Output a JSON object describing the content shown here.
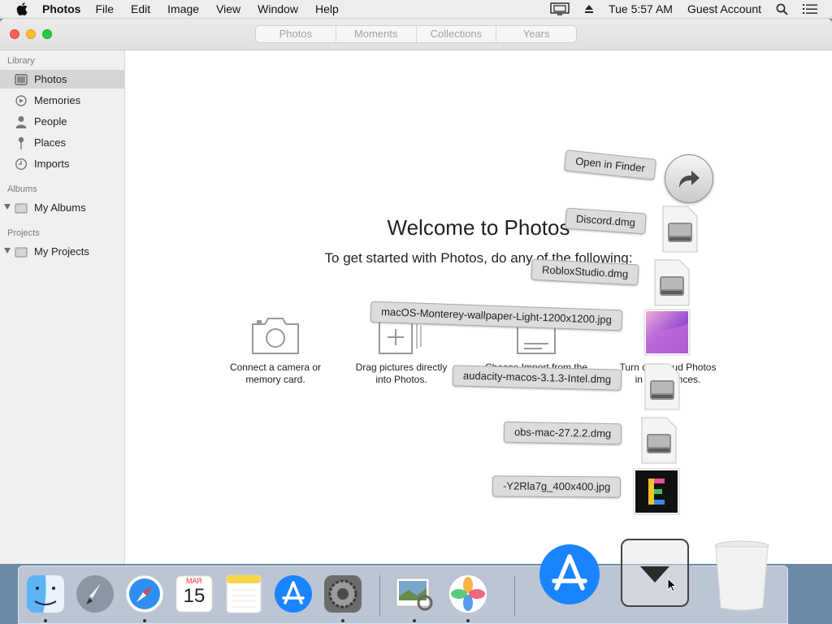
{
  "menubar": {
    "app_name": "Photos",
    "menus": [
      "File",
      "Edit",
      "Image",
      "View",
      "Window",
      "Help"
    ],
    "clock": "Tue 5:57 AM",
    "user": "Guest Account",
    "icons": [
      "apple-logo",
      "display-mirror-icon",
      "eject-icon",
      "search-icon",
      "list-icon"
    ]
  },
  "toolbar": {
    "tabs": [
      "Photos",
      "Moments",
      "Collections",
      "Years"
    ]
  },
  "sidebar": {
    "library_heading": "Library",
    "library_items": [
      {
        "label": "Photos",
        "icon": "photos-icon",
        "selected": true
      },
      {
        "label": "Memories",
        "icon": "memories-icon"
      },
      {
        "label": "People",
        "icon": "person-icon"
      },
      {
        "label": "Places",
        "icon": "pin-icon"
      },
      {
        "label": "Imports",
        "icon": "clock-icon"
      }
    ],
    "albums_heading": "Albums",
    "albums_item": "My Albums",
    "projects_heading": "Projects",
    "projects_item": "My Projects"
  },
  "main": {
    "title": "Welcome to Photos",
    "subtitle": "To get started with Photos, do any of the following:",
    "options": [
      {
        "label_line1": "Connect a camera or",
        "label_line2": "memory card.",
        "icon": "camera-icon"
      },
      {
        "label_line1": "Drag pictures directly",
        "label_line2": "into Photos.",
        "icon": "drag-add-icon"
      },
      {
        "label_line1": "Choose Import from the",
        "label_line2": "",
        "icon": "import-icon"
      },
      {
        "label_line1": "Turn on iCloud Photos",
        "label_line2": "in Preferences.",
        "icon": "icloud-icon"
      }
    ]
  },
  "stack": {
    "open_in_finder": "Open in Finder",
    "files": [
      {
        "name": "Discord.dmg",
        "icon": "dmg-icon"
      },
      {
        "name": "RobloxStudio.dmg",
        "icon": "dmg-icon"
      },
      {
        "name": "macOS-Monterey-wallpaper-Light-1200x1200.jpg",
        "icon": "image-thumbnail-icon"
      },
      {
        "name": "audacity-macos-3.1.3-Intel.dmg",
        "icon": "dmg-icon"
      },
      {
        "name": "obs-mac-27.2.2.dmg",
        "icon": "dmg-icon"
      },
      {
        "name": "-Y2Rla7g_400x400.jpg",
        "icon": "image-thumbnail-icon"
      }
    ]
  },
  "dock": {
    "apps": [
      "Finder",
      "Launchpad",
      "Safari",
      "Calendar",
      "Notes",
      "App Store",
      "System Preferences",
      "Preview",
      "Photos"
    ],
    "calendar_month": "MAR",
    "calendar_day": "15",
    "right_items": [
      "App Store",
      "Downloads stack",
      "Trash"
    ]
  },
  "colors": {
    "accent": "#1a84ff",
    "close": "#fe5f57",
    "minimize": "#febc2e",
    "maximize": "#28c840"
  }
}
